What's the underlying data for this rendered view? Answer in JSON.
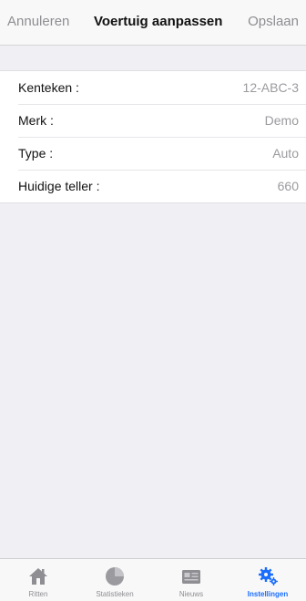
{
  "navbar": {
    "cancel_label": "Annuleren",
    "title": "Voertuig aanpassen",
    "save_label": "Opslaan"
  },
  "form": {
    "rows": [
      {
        "label": "Kenteken :",
        "value": "12-ABC-3"
      },
      {
        "label": "Merk :",
        "value": "Demo"
      },
      {
        "label": "Type :",
        "value": "Auto"
      },
      {
        "label": "Huidige teller :",
        "value": "660"
      }
    ]
  },
  "tabbar": {
    "tabs": [
      {
        "label": "Ritten",
        "icon": "home-icon",
        "active": false
      },
      {
        "label": "Statistieken",
        "icon": "pie-chart-icon",
        "active": false
      },
      {
        "label": "Nieuws",
        "icon": "news-icon",
        "active": false
      },
      {
        "label": "Instellingen",
        "icon": "gears-icon",
        "active": true
      }
    ]
  },
  "colors": {
    "accent": "#1a6dff",
    "inactive": "#8e8e93",
    "background": "#efeff4"
  }
}
